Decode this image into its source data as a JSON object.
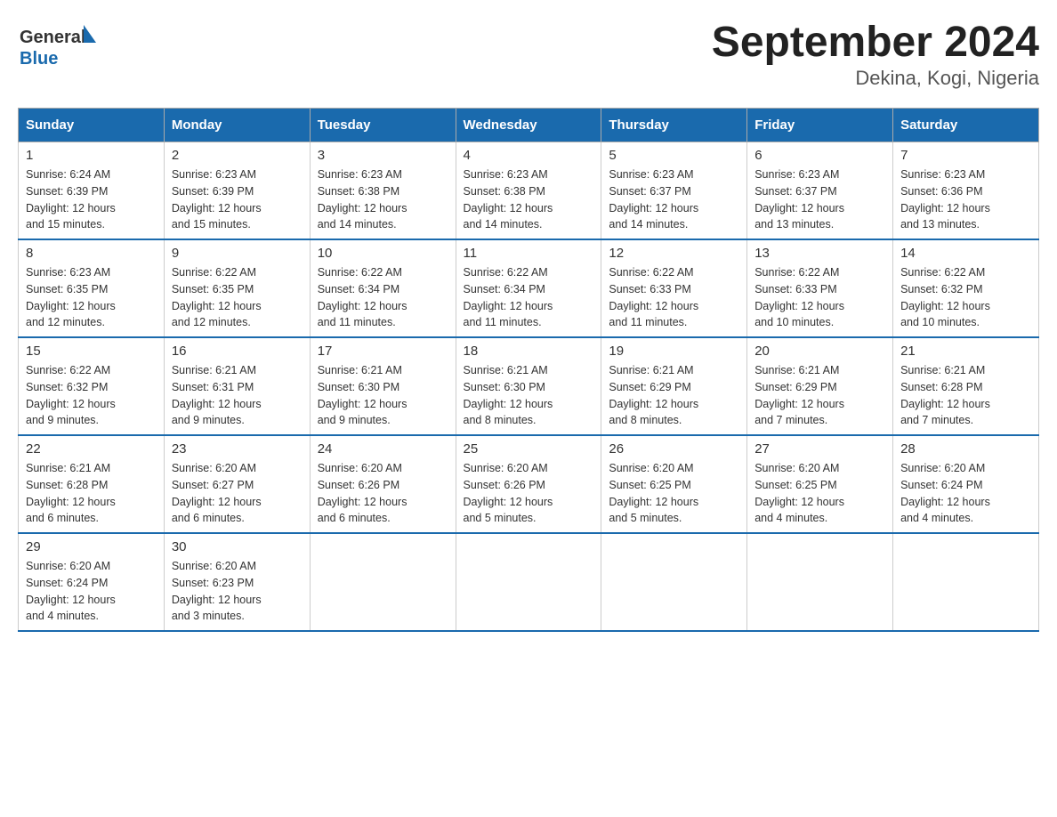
{
  "header": {
    "logo_text1": "General",
    "logo_text2": "Blue",
    "month_title": "September 2024",
    "location": "Dekina, Kogi, Nigeria"
  },
  "weekdays": [
    "Sunday",
    "Monday",
    "Tuesday",
    "Wednesday",
    "Thursday",
    "Friday",
    "Saturday"
  ],
  "weeks": [
    [
      {
        "day": "1",
        "sunrise": "6:24 AM",
        "sunset": "6:39 PM",
        "daylight": "12 hours and 15 minutes."
      },
      {
        "day": "2",
        "sunrise": "6:23 AM",
        "sunset": "6:39 PM",
        "daylight": "12 hours and 15 minutes."
      },
      {
        "day": "3",
        "sunrise": "6:23 AM",
        "sunset": "6:38 PM",
        "daylight": "12 hours and 14 minutes."
      },
      {
        "day": "4",
        "sunrise": "6:23 AM",
        "sunset": "6:38 PM",
        "daylight": "12 hours and 14 minutes."
      },
      {
        "day": "5",
        "sunrise": "6:23 AM",
        "sunset": "6:37 PM",
        "daylight": "12 hours and 14 minutes."
      },
      {
        "day": "6",
        "sunrise": "6:23 AM",
        "sunset": "6:37 PM",
        "daylight": "12 hours and 13 minutes."
      },
      {
        "day": "7",
        "sunrise": "6:23 AM",
        "sunset": "6:36 PM",
        "daylight": "12 hours and 13 minutes."
      }
    ],
    [
      {
        "day": "8",
        "sunrise": "6:23 AM",
        "sunset": "6:35 PM",
        "daylight": "12 hours and 12 minutes."
      },
      {
        "day": "9",
        "sunrise": "6:22 AM",
        "sunset": "6:35 PM",
        "daylight": "12 hours and 12 minutes."
      },
      {
        "day": "10",
        "sunrise": "6:22 AM",
        "sunset": "6:34 PM",
        "daylight": "12 hours and 11 minutes."
      },
      {
        "day": "11",
        "sunrise": "6:22 AM",
        "sunset": "6:34 PM",
        "daylight": "12 hours and 11 minutes."
      },
      {
        "day": "12",
        "sunrise": "6:22 AM",
        "sunset": "6:33 PM",
        "daylight": "12 hours and 11 minutes."
      },
      {
        "day": "13",
        "sunrise": "6:22 AM",
        "sunset": "6:33 PM",
        "daylight": "12 hours and 10 minutes."
      },
      {
        "day": "14",
        "sunrise": "6:22 AM",
        "sunset": "6:32 PM",
        "daylight": "12 hours and 10 minutes."
      }
    ],
    [
      {
        "day": "15",
        "sunrise": "6:22 AM",
        "sunset": "6:32 PM",
        "daylight": "12 hours and 9 minutes."
      },
      {
        "day": "16",
        "sunrise": "6:21 AM",
        "sunset": "6:31 PM",
        "daylight": "12 hours and 9 minutes."
      },
      {
        "day": "17",
        "sunrise": "6:21 AM",
        "sunset": "6:30 PM",
        "daylight": "12 hours and 9 minutes."
      },
      {
        "day": "18",
        "sunrise": "6:21 AM",
        "sunset": "6:30 PM",
        "daylight": "12 hours and 8 minutes."
      },
      {
        "day": "19",
        "sunrise": "6:21 AM",
        "sunset": "6:29 PM",
        "daylight": "12 hours and 8 minutes."
      },
      {
        "day": "20",
        "sunrise": "6:21 AM",
        "sunset": "6:29 PM",
        "daylight": "12 hours and 7 minutes."
      },
      {
        "day": "21",
        "sunrise": "6:21 AM",
        "sunset": "6:28 PM",
        "daylight": "12 hours and 7 minutes."
      }
    ],
    [
      {
        "day": "22",
        "sunrise": "6:21 AM",
        "sunset": "6:28 PM",
        "daylight": "12 hours and 6 minutes."
      },
      {
        "day": "23",
        "sunrise": "6:20 AM",
        "sunset": "6:27 PM",
        "daylight": "12 hours and 6 minutes."
      },
      {
        "day": "24",
        "sunrise": "6:20 AM",
        "sunset": "6:26 PM",
        "daylight": "12 hours and 6 minutes."
      },
      {
        "day": "25",
        "sunrise": "6:20 AM",
        "sunset": "6:26 PM",
        "daylight": "12 hours and 5 minutes."
      },
      {
        "day": "26",
        "sunrise": "6:20 AM",
        "sunset": "6:25 PM",
        "daylight": "12 hours and 5 minutes."
      },
      {
        "day": "27",
        "sunrise": "6:20 AM",
        "sunset": "6:25 PM",
        "daylight": "12 hours and 4 minutes."
      },
      {
        "day": "28",
        "sunrise": "6:20 AM",
        "sunset": "6:24 PM",
        "daylight": "12 hours and 4 minutes."
      }
    ],
    [
      {
        "day": "29",
        "sunrise": "6:20 AM",
        "sunset": "6:24 PM",
        "daylight": "12 hours and 4 minutes."
      },
      {
        "day": "30",
        "sunrise": "6:20 AM",
        "sunset": "6:23 PM",
        "daylight": "12 hours and 3 minutes."
      },
      null,
      null,
      null,
      null,
      null
    ]
  ],
  "labels": {
    "sunrise": "Sunrise:",
    "sunset": "Sunset:",
    "daylight": "Daylight:"
  }
}
